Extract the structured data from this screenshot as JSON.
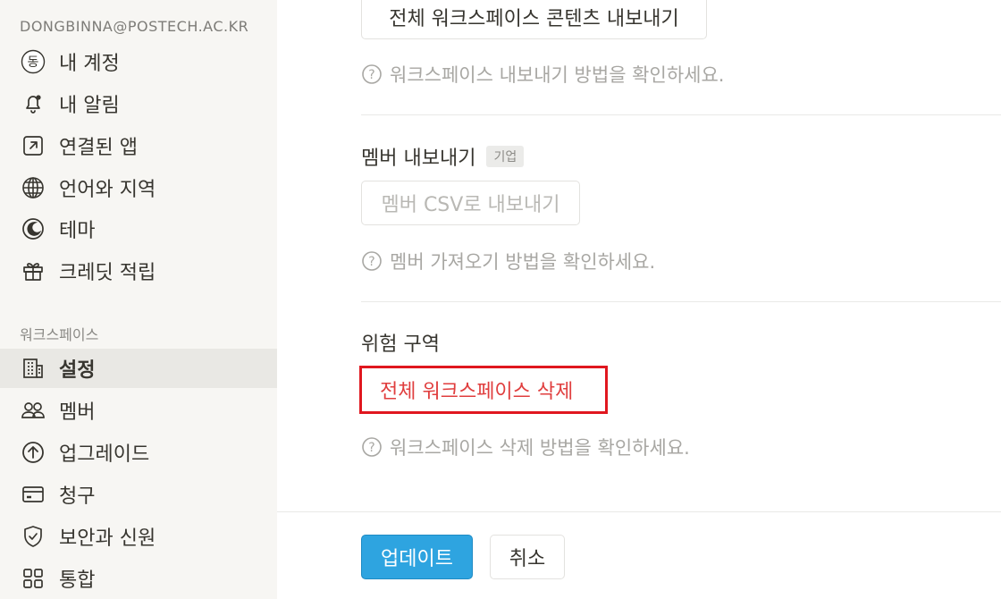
{
  "sidebar": {
    "account_email": "DONGBINNA@POSTECH.AC.KR",
    "account_items": [
      {
        "label": "내 계정",
        "icon": "avatar-icon",
        "avatar_char": "동"
      },
      {
        "label": "내 알림",
        "icon": "bell-icon"
      },
      {
        "label": "연결된 앱",
        "icon": "arrow-out-square-icon"
      },
      {
        "label": "언어와 지역",
        "icon": "globe-icon"
      },
      {
        "label": "테마",
        "icon": "moon-icon"
      },
      {
        "label": "크레딧 적립",
        "icon": "gift-icon"
      }
    ],
    "workspace_title": "워크스페이스",
    "workspace_items": [
      {
        "label": "설정",
        "icon": "building-icon",
        "active": true
      },
      {
        "label": "멤버",
        "icon": "people-icon"
      },
      {
        "label": "업그레이드",
        "icon": "arrow-up-circle-icon"
      },
      {
        "label": "청구",
        "icon": "credit-card-icon"
      },
      {
        "label": "보안과 신원",
        "icon": "shield-check-icon"
      },
      {
        "label": "통합",
        "icon": "grid-icon"
      }
    ]
  },
  "main": {
    "export_content_button": "전체 워크스페이스 콘텐츠 내보내기",
    "export_help": "워크스페이스 내보내기 방법을 확인하세요.",
    "export_members_title": "멤버 내보내기",
    "enterprise_badge": "기업",
    "export_members_button": "멤버 CSV로 내보내기",
    "export_members_help": "멤버 가져오기 방법을 확인하세요.",
    "danger_zone_title": "위험 구역",
    "delete_workspace_button": "전체 워크스페이스 삭제",
    "delete_help": "워크스페이스 삭제 방법을 확인하세요.",
    "update_button": "업데이트",
    "cancel_button": "취소"
  },
  "colors": {
    "primary": "#2ea4e0",
    "danger": "#e03e3e",
    "highlight_box": "#e0171f",
    "sidebar_bg": "#f7f6f3"
  }
}
